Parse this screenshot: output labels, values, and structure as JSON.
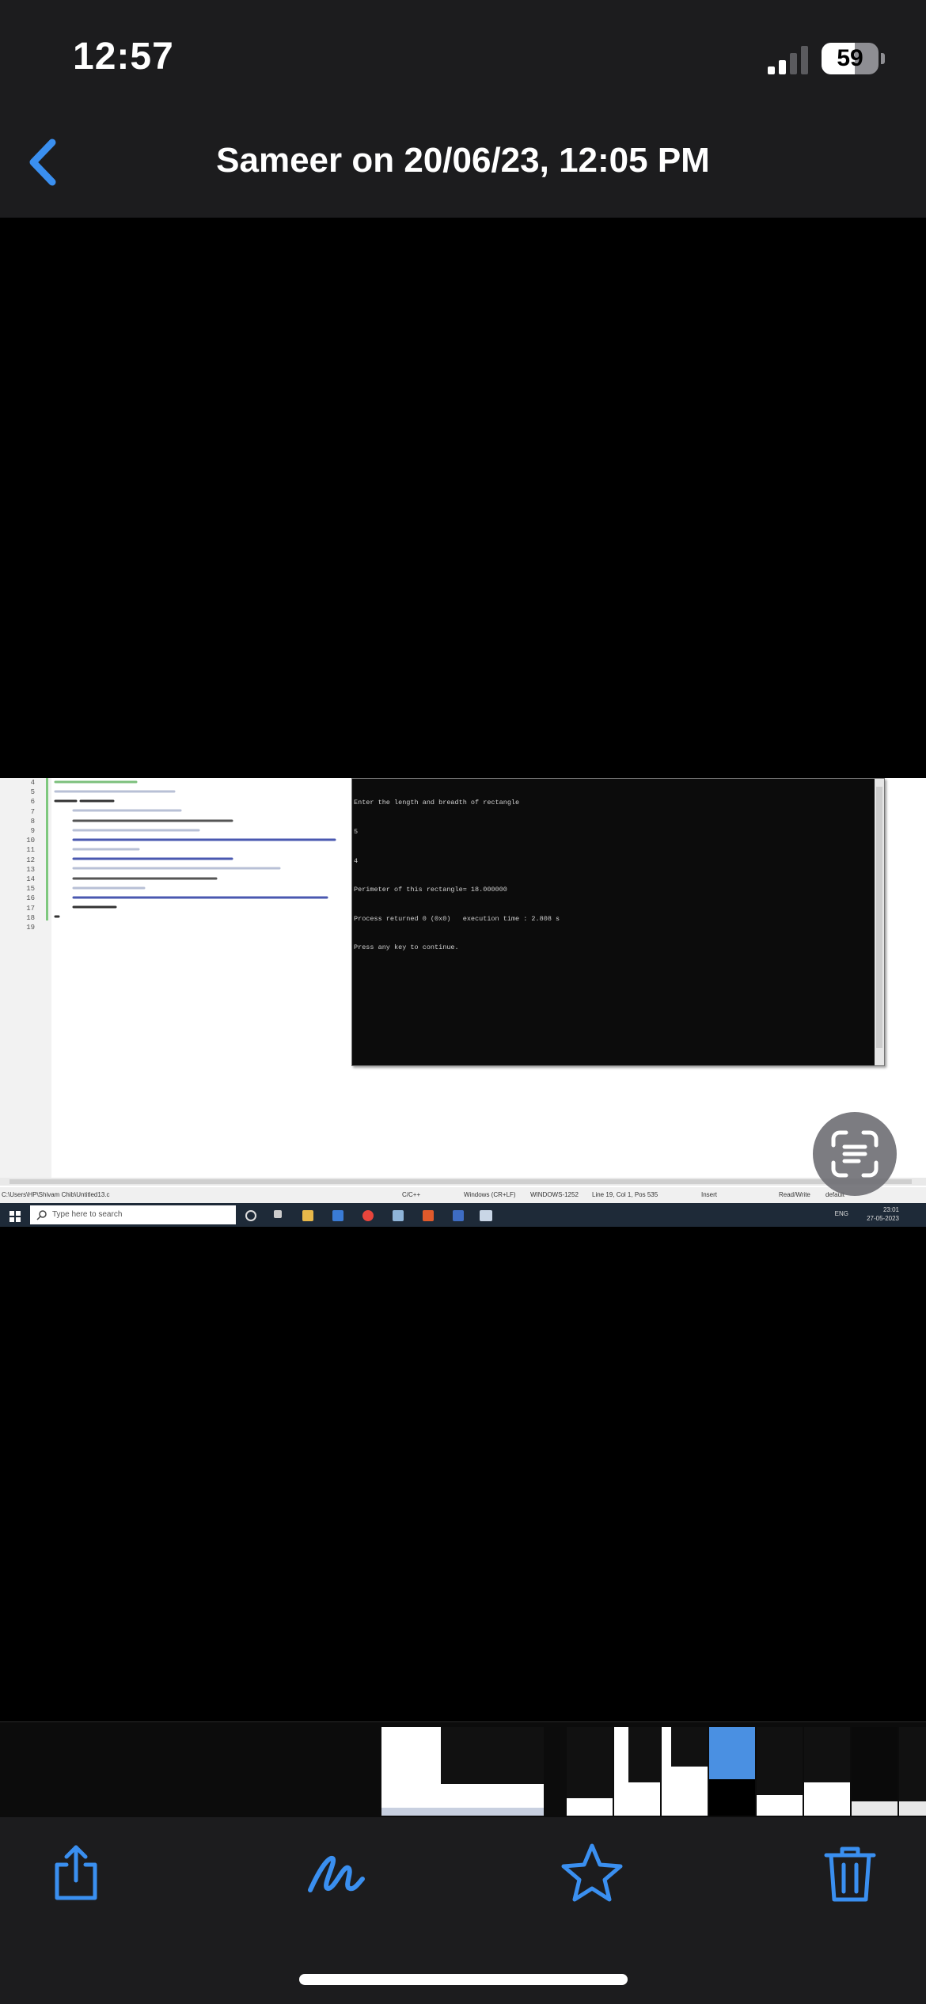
{
  "status_bar": {
    "time": "12:57",
    "battery_level": "59"
  },
  "nav": {
    "title": "Sameer on 20/06/23, 12:05 PM"
  },
  "screenshot": {
    "line_numbers": [
      "4",
      "5",
      "6",
      "7",
      "8",
      "9",
      "10",
      "11",
      "12",
      "13",
      "14",
      "15",
      "16",
      "17",
      "18",
      "19"
    ],
    "console_lines": [
      "Enter the length and breadth of rectangle",
      "5",
      "4",
      "Perimeter of this rectangle= 18.000000",
      "Process returned 0 (0x0)   execution time : 2.808 s",
      "Press any key to continue."
    ],
    "status": {
      "path": "C:\\Users\\HP\\Shivam Chib\\Untitled13.c",
      "lang": "C/C++",
      "eol": "Windows (CR+LF)",
      "encoding": "WINDOWS-1252",
      "position": "Line 19, Col 1, Pos 535",
      "mode": "Insert",
      "access": "Read/Write",
      "profile": "default"
    },
    "taskbar": {
      "search_placeholder": "Type here to search",
      "lang": "ENG",
      "clock": "23:01",
      "date": "27-05-2023"
    }
  },
  "toolbar": {
    "share": "share-icon",
    "markup": "markup-icon",
    "favorite": "star-icon",
    "delete": "trash-icon"
  },
  "accent_color": "#3a8ff0"
}
